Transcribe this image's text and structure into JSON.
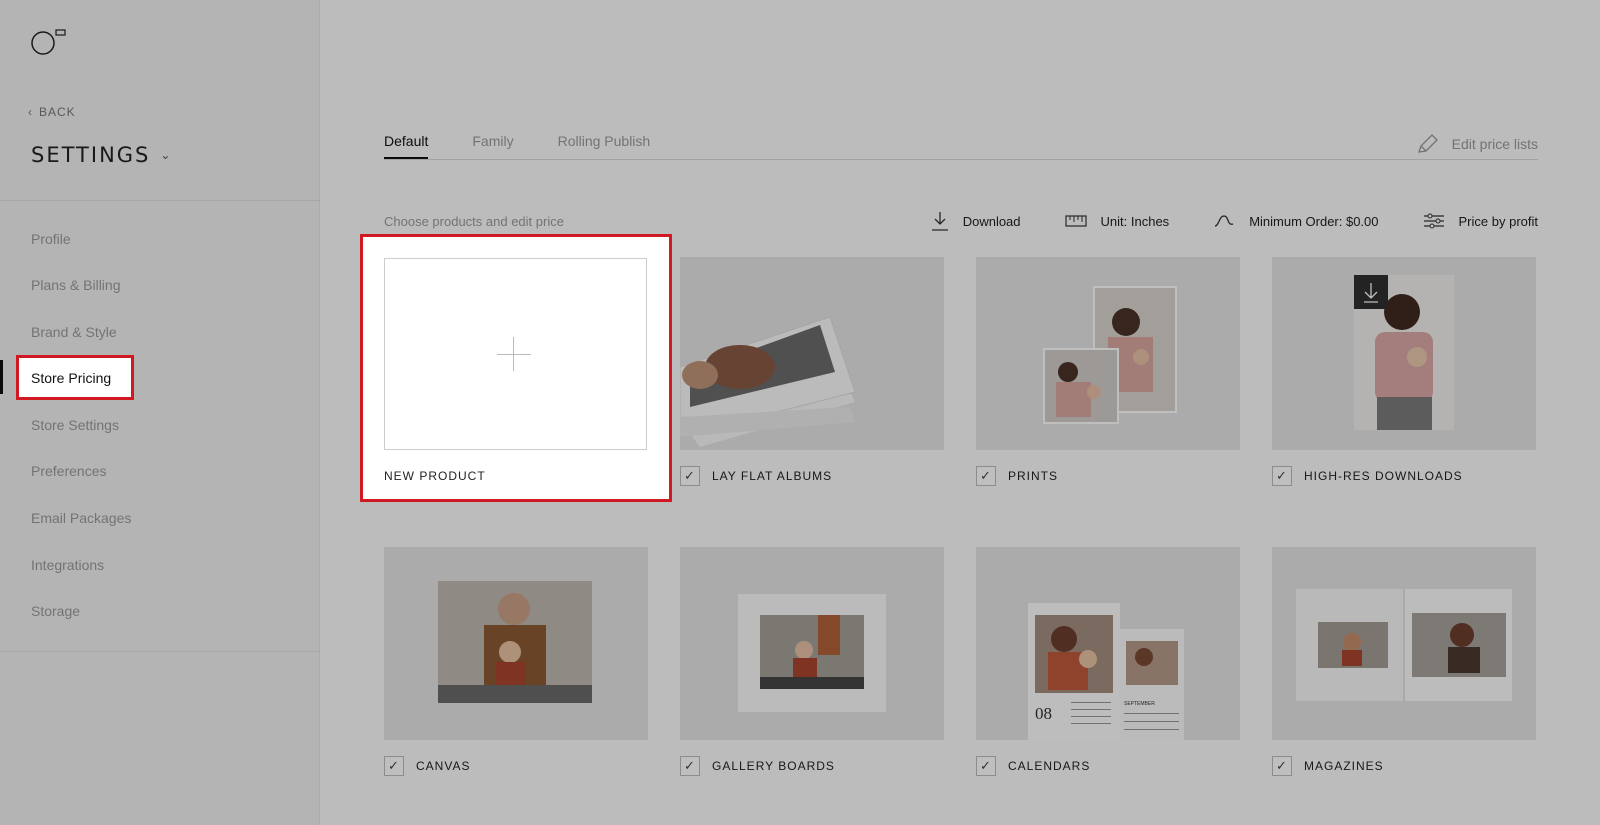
{
  "sidebar": {
    "back_label": "BACK",
    "title": "SETTINGS",
    "items": [
      {
        "label": "Profile"
      },
      {
        "label": "Plans & Billing"
      },
      {
        "label": "Brand & Style"
      },
      {
        "label": "Store Pricing"
      },
      {
        "label": "Store Settings"
      },
      {
        "label": "Preferences"
      },
      {
        "label": "Email Packages"
      },
      {
        "label": "Integrations"
      },
      {
        "label": "Storage"
      }
    ],
    "active_index": 3
  },
  "tabs": [
    {
      "label": "Default",
      "active": true
    },
    {
      "label": "Family",
      "active": false
    },
    {
      "label": "Rolling Publish",
      "active": false
    }
  ],
  "edit_price_lists": "Edit price lists",
  "toolbar": {
    "hint": "Choose products and edit price",
    "download": "Download",
    "unit": "Unit: Inches",
    "minimum_order": "Minimum Order: $0.00",
    "price_by_profit": "Price by profit"
  },
  "new_product_label": "NEW PRODUCT",
  "products": [
    {
      "label": "LAY FLAT ALBUMS",
      "checked": true
    },
    {
      "label": "PRINTS",
      "checked": true
    },
    {
      "label": "HIGH-RES DOWNLOADS",
      "checked": true
    },
    {
      "label": "CANVAS",
      "checked": true
    },
    {
      "label": "GALLERY BOARDS",
      "checked": true
    },
    {
      "label": "CALENDARS",
      "checked": true
    },
    {
      "label": "MAGAZINES",
      "checked": true
    }
  ],
  "calendar_number": "08",
  "calendar_month": "SEPTEMBER",
  "colors": {
    "highlight": "#d01922",
    "text": "#222222",
    "muted": "#9a9a9a"
  }
}
